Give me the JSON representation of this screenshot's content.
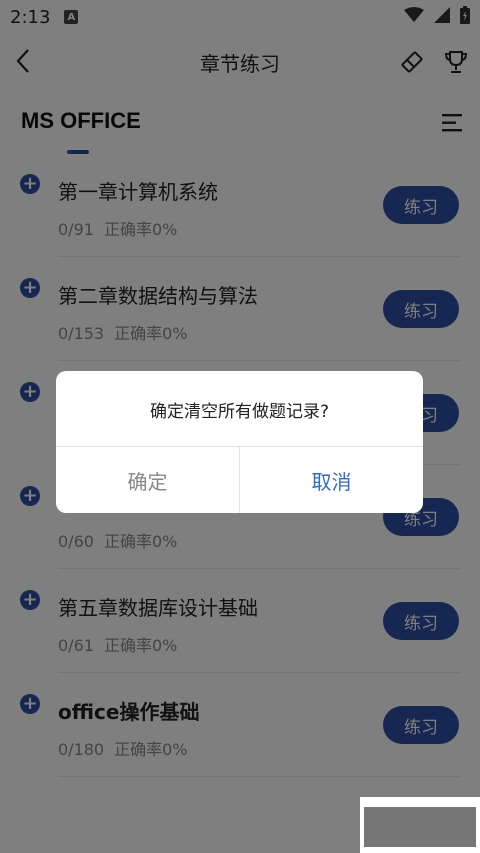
{
  "status": {
    "time": "2:13",
    "badge": "A"
  },
  "topbar": {
    "title": "章节练习"
  },
  "subject": "MS OFFICE",
  "chapters": [
    {
      "name": "第一章计算机系统",
      "progress": "0/91",
      "accuracy": "正确率0%",
      "button": "练习"
    },
    {
      "name": "第二章数据结构与算法",
      "progress": "0/153",
      "accuracy": "正确率0%",
      "button": "练习"
    },
    {
      "name": "",
      "progress": "",
      "accuracy": "",
      "button": "练习"
    },
    {
      "name": "",
      "progress": "0/60",
      "accuracy": "正确率0%",
      "button": "练习"
    },
    {
      "name": "第五章数据库设计基础",
      "progress": "0/61",
      "accuracy": "正确率0%",
      "button": "练习"
    },
    {
      "name": "office操作基础",
      "progress": "0/180",
      "accuracy": "正确率0%",
      "button": "练习"
    }
  ],
  "dialog": {
    "message": "确定清空所有做题记录?",
    "confirm": "确定",
    "cancel": "取消"
  },
  "colors": {
    "accent": "#2d4fa3",
    "cancel_text": "#2d6ad6"
  }
}
